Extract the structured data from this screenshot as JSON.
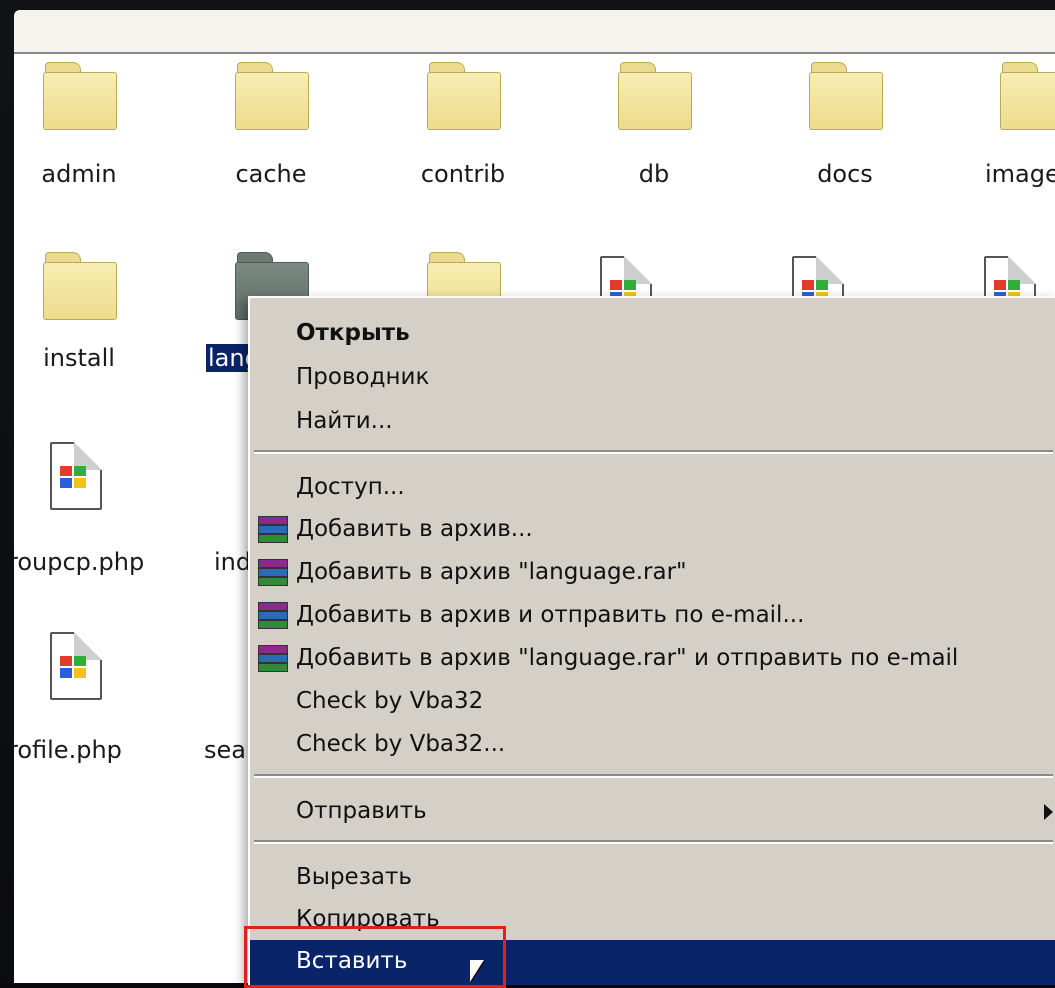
{
  "files": [
    {
      "name": "admin",
      "type": "folder"
    },
    {
      "name": "cache",
      "type": "folder"
    },
    {
      "name": "contrib",
      "type": "folder"
    },
    {
      "name": "db",
      "type": "folder"
    },
    {
      "name": "docs",
      "type": "folder"
    },
    {
      "name": "image",
      "type": "folder"
    },
    {
      "name": "install",
      "type": "folder"
    },
    {
      "name": "lang",
      "type": "folder",
      "selected": true
    },
    {
      "name": "",
      "type": "folder"
    },
    {
      "name": "",
      "type": "php"
    },
    {
      "name": "",
      "type": "php"
    },
    {
      "name": "",
      "type": "php"
    },
    {
      "name": "roupcp.php",
      "type": "php"
    },
    {
      "name": "inde",
      "type": "php"
    },
    {
      "name": "rofile.php",
      "type": "php"
    },
    {
      "name": "searc",
      "type": "php"
    }
  ],
  "context_menu": {
    "items": [
      {
        "label": "Открыть",
        "bold": true
      },
      {
        "label": "Проводник"
      },
      {
        "label": "Найти..."
      },
      {
        "label": "Доступ..."
      },
      {
        "label": "Добавить в архив...",
        "icon": "winrar-icon"
      },
      {
        "label": "Добавить в архив \"language.rar\"",
        "icon": "winrar-icon"
      },
      {
        "label": "Добавить в архив и отправить по e-mail...",
        "icon": "winrar-icon"
      },
      {
        "label": "Добавить в архив \"language.rar\" и отправить по e-mail",
        "icon": "winrar-icon"
      },
      {
        "label": "Check by Vba32"
      },
      {
        "label": "Check by Vba32..."
      },
      {
        "label": "Отправить",
        "submenu": true
      },
      {
        "label": "Вырезать"
      },
      {
        "label": "Копировать"
      },
      {
        "label": "Вставить",
        "highlighted": true
      }
    ]
  },
  "colors": {
    "menu_bg": "#d4d0c8",
    "highlight": "#0a246a",
    "callout": "#e0201e",
    "folder": "#f3e49c"
  }
}
